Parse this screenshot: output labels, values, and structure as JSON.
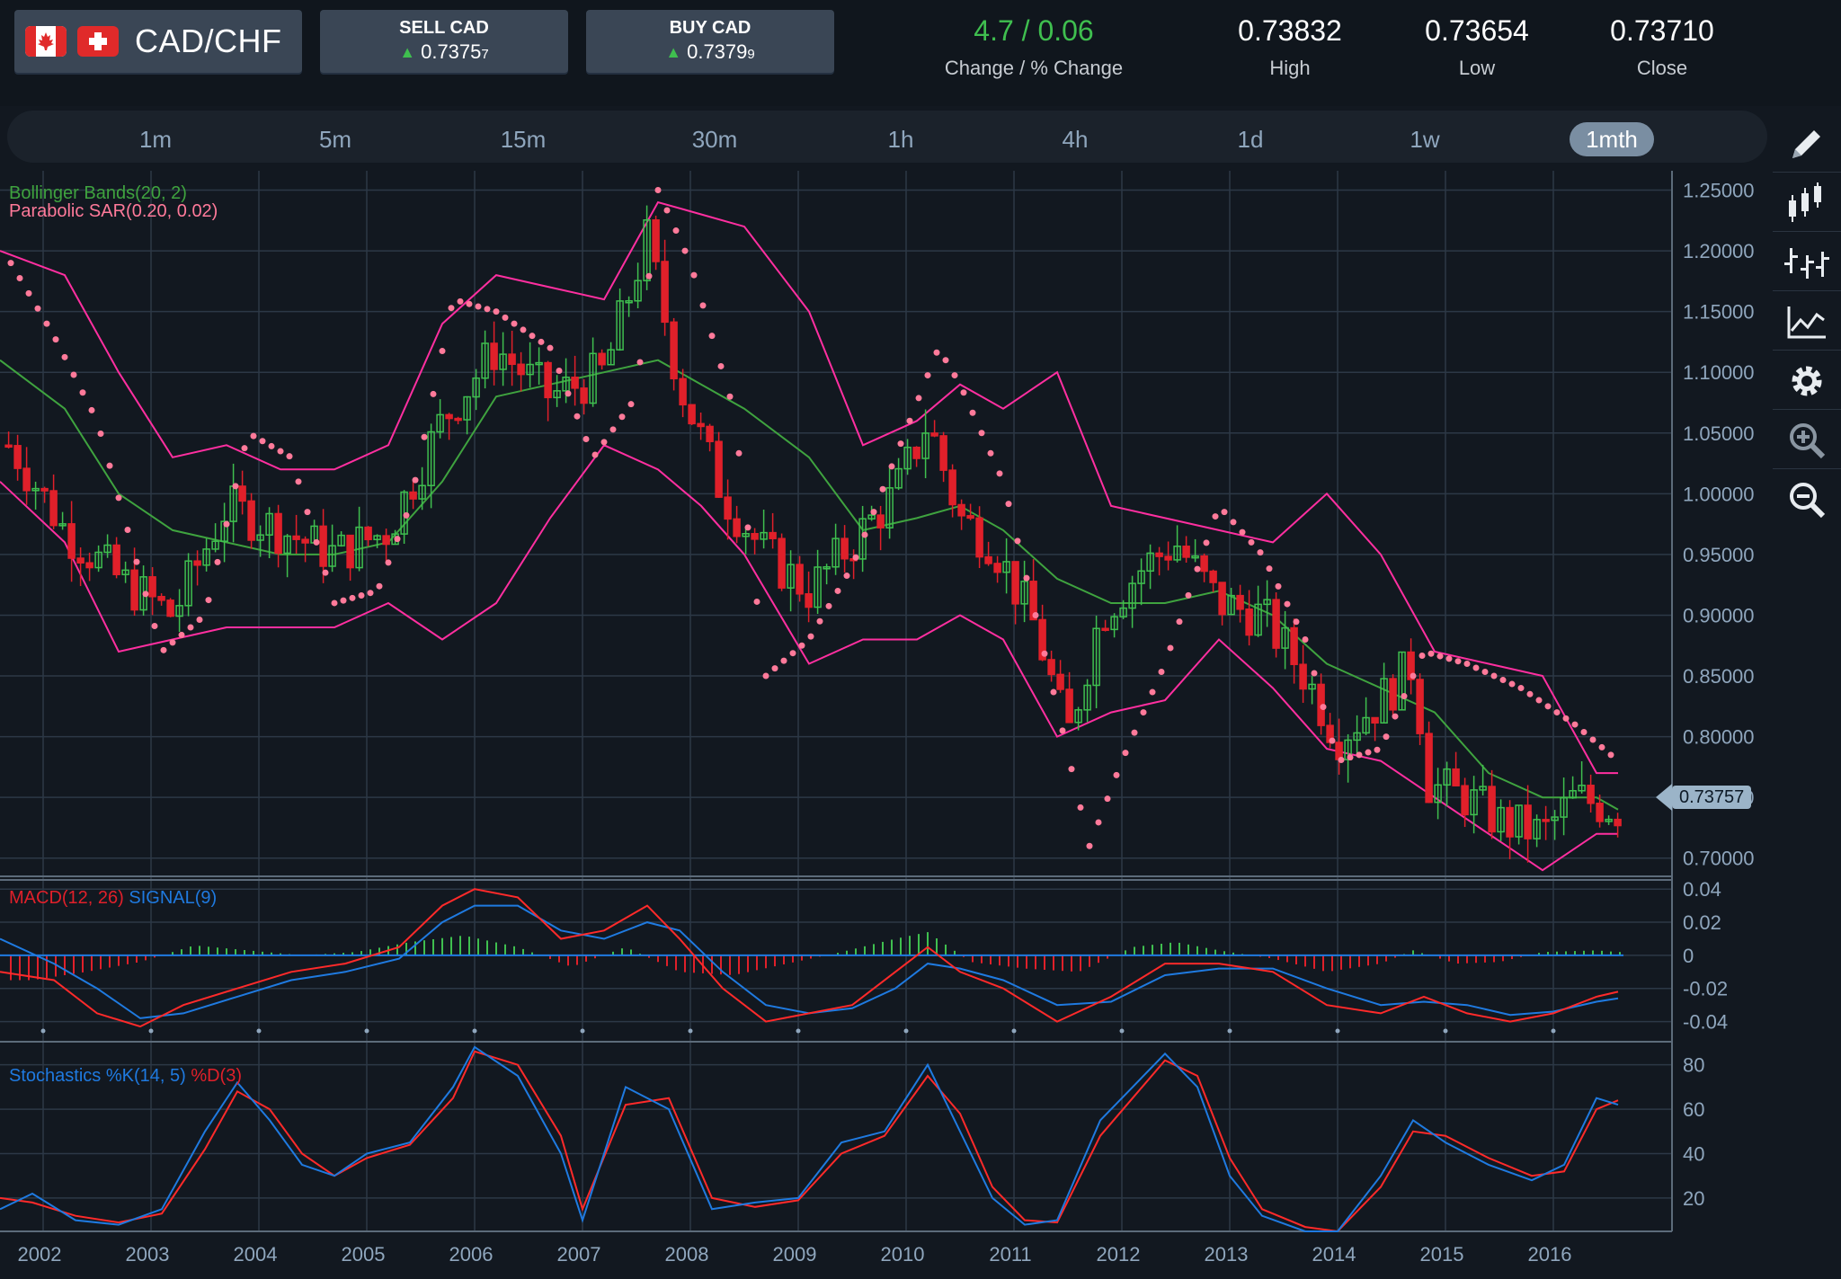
{
  "pair": {
    "name": "CAD/CHF",
    "flag_left": "canada-flag",
    "flag_right": "switzerland-flag"
  },
  "sell": {
    "label": "SELL CAD",
    "price": "0.7375",
    "pip": "7",
    "arrow_icon": "triangle-up-icon"
  },
  "buy": {
    "label": "BUY CAD",
    "price": "0.7379",
    "pip": "9",
    "arrow_icon": "triangle-up-icon"
  },
  "stats": [
    {
      "value": "4.7 / 0.06",
      "label": "Change / % Change",
      "color": "#3fbf4f"
    },
    {
      "value": "0.73832",
      "label": "High",
      "color": "#ffffff"
    },
    {
      "value": "0.73654",
      "label": "Low",
      "color": "#ffffff"
    },
    {
      "value": "0.73710",
      "label": "Close",
      "color": "#ffffff"
    }
  ],
  "timeframes": [
    "1m",
    "5m",
    "15m",
    "30m",
    "1h",
    "4h",
    "1d",
    "1w",
    "1mth"
  ],
  "active_timeframe": "1mth",
  "tools": [
    "pencil-icon",
    "candlestick-icon",
    "bar-chart-icon",
    "line-chart-icon",
    "gear-icon",
    "zoom-in-icon",
    "zoom-out-icon"
  ],
  "legends": {
    "bollinger": "Bollinger Bands(20, 2)",
    "sar": "Parabolic SAR(0.20, 0.02)",
    "macd": "MACD(12, 26)",
    "signal": "SIGNAL(9)",
    "stoch_k": "Stochastics %K(14, 5)",
    "stoch_d": "%D(3)"
  },
  "current_price": "0.73757",
  "colors": {
    "up": "#3fbf4f",
    "down": "#e0202a",
    "bands": "#ff2fa0",
    "mid": "#3fa33f",
    "sar": "#ff7a9a",
    "signal": "#1f7ae0",
    "macd": "#ff2a2a"
  },
  "chart_data": [
    {
      "type": "candlestick",
      "title": "",
      "x_ticks": [
        "2002",
        "2003",
        "2004",
        "2005",
        "2006",
        "2007",
        "2008",
        "2009",
        "2010",
        "2011",
        "2012",
        "2013",
        "2014",
        "2015",
        "2016"
      ],
      "y_ticks": [
        "1.25000",
        "1.20000",
        "1.15000",
        "1.10000",
        "1.05000",
        "1.00000",
        "0.95000",
        "0.90000",
        "0.85000",
        "0.80000",
        "0.75000",
        "0.70000"
      ],
      "ylim": [
        0.685,
        1.26
      ],
      "xlim": [
        2001.7,
        2017.2
      ],
      "series": [
        {
          "name": "Close",
          "x": [
            2001.8,
            2002.3,
            2002.8,
            2003.3,
            2003.8,
            2004.3,
            2004.8,
            2005.3,
            2005.8,
            2006.3,
            2006.8,
            2007.3,
            2007.7,
            2008.0,
            2008.4,
            2008.8,
            2009.2,
            2009.6,
            2010.0,
            2010.3,
            2010.6,
            2010.9,
            2011.3,
            2011.6,
            2011.9,
            2012.3,
            2012.6,
            2013.0,
            2013.4,
            2013.8,
            2014.1,
            2014.5,
            2014.8,
            2014.95,
            2015.3,
            2015.6,
            2016.0,
            2016.3,
            2016.7
          ],
          "y": [
            1.04,
            0.97,
            0.93,
            0.9,
            0.99,
            0.97,
            0.95,
            0.97,
            1.06,
            1.12,
            1.08,
            1.1,
            1.21,
            1.09,
            1.0,
            0.95,
            0.92,
            0.96,
            1.0,
            1.06,
            0.98,
            0.96,
            0.89,
            0.8,
            0.9,
            0.94,
            0.96,
            0.91,
            0.9,
            0.85,
            0.8,
            0.83,
            0.86,
            0.76,
            0.75,
            0.73,
            0.72,
            0.75,
            0.74
          ]
        },
        {
          "name": "Bollinger upper",
          "x": [
            2001.7,
            2002.3,
            2002.8,
            2003.3,
            2003.8,
            2004.3,
            2004.8,
            2005.3,
            2005.8,
            2006.3,
            2006.8,
            2007.3,
            2007.8,
            2008.2,
            2008.6,
            2009.2,
            2009.7,
            2010.2,
            2010.6,
            2011.0,
            2011.5,
            2012.0,
            2012.5,
            2013.0,
            2013.5,
            2014.0,
            2014.5,
            2015.0,
            2015.5,
            2016.0,
            2016.5,
            2016.7
          ],
          "y": [
            1.2,
            1.18,
            1.1,
            1.03,
            1.04,
            1.02,
            1.02,
            1.04,
            1.14,
            1.18,
            1.17,
            1.16,
            1.24,
            1.23,
            1.22,
            1.15,
            1.04,
            1.06,
            1.09,
            1.07,
            1.1,
            0.99,
            0.98,
            0.97,
            0.96,
            1.0,
            0.95,
            0.87,
            0.86,
            0.85,
            0.77,
            0.77
          ]
        },
        {
          "name": "Bollinger middle",
          "x": [
            2001.7,
            2002.3,
            2002.8,
            2003.3,
            2003.8,
            2004.3,
            2004.8,
            2005.3,
            2005.8,
            2006.3,
            2006.8,
            2007.3,
            2007.8,
            2008.2,
            2008.6,
            2009.2,
            2009.7,
            2010.2,
            2010.6,
            2011.0,
            2011.5,
            2012.0,
            2012.5,
            2013.0,
            2013.5,
            2014.0,
            2014.5,
            2015.0,
            2015.5,
            2016.0,
            2016.5,
            2016.7
          ],
          "y": [
            1.11,
            1.07,
            1.0,
            0.97,
            0.96,
            0.95,
            0.95,
            0.96,
            1.01,
            1.08,
            1.09,
            1.1,
            1.11,
            1.09,
            1.07,
            1.03,
            0.97,
            0.98,
            0.99,
            0.97,
            0.93,
            0.91,
            0.91,
            0.92,
            0.9,
            0.86,
            0.84,
            0.82,
            0.77,
            0.75,
            0.75,
            0.74
          ]
        },
        {
          "name": "Bollinger lower",
          "x": [
            2001.7,
            2002.3,
            2002.8,
            2003.3,
            2003.8,
            2004.3,
            2004.8,
            2005.3,
            2005.8,
            2006.3,
            2006.8,
            2007.3,
            2007.8,
            2008.2,
            2008.6,
            2009.2,
            2009.7,
            2010.2,
            2010.6,
            2011.0,
            2011.5,
            2012.0,
            2012.5,
            2013.0,
            2013.5,
            2014.0,
            2014.5,
            2015.0,
            2015.5,
            2016.0,
            2016.5,
            2016.7
          ],
          "y": [
            1.01,
            0.96,
            0.87,
            0.88,
            0.89,
            0.89,
            0.89,
            0.91,
            0.88,
            0.91,
            0.98,
            1.04,
            1.02,
            0.99,
            0.95,
            0.86,
            0.88,
            0.88,
            0.9,
            0.88,
            0.8,
            0.82,
            0.83,
            0.88,
            0.84,
            0.79,
            0.78,
            0.75,
            0.72,
            0.69,
            0.72,
            0.72
          ]
        },
        {
          "name": "SAR",
          "x": [
            2001.8,
            2002.2,
            2002.6,
            2003.2,
            2003.6,
            2004.0,
            2004.4,
            2004.8,
            2005.2,
            2005.5,
            2005.9,
            2006.3,
            2006.8,
            2007.2,
            2007.6,
            2007.8,
            2008.1,
            2008.5,
            2008.8,
            2009.2,
            2009.6,
            2010.0,
            2010.4,
            2010.6,
            2011.0,
            2011.3,
            2011.8,
            2012.1,
            2012.5,
            2013.0,
            2013.4,
            2013.8,
            2014.1,
            2014.5,
            2014.9,
            2015.3,
            2015.8,
            2016.3,
            2016.7
          ],
          "y": [
            1.19,
            1.13,
            1.06,
            0.87,
            0.9,
            1.05,
            1.03,
            0.91,
            0.92,
            0.99,
            1.16,
            1.15,
            1.12,
            1.03,
            1.08,
            1.25,
            1.19,
            1.07,
            0.85,
            0.88,
            0.94,
            1.03,
            1.12,
            1.09,
            1.01,
            0.9,
            0.71,
            0.78,
            0.86,
            0.99,
            0.95,
            0.88,
            0.78,
            0.79,
            0.87,
            0.86,
            0.84,
            0.81,
            0.78
          ]
        }
      ]
    },
    {
      "type": "line",
      "title": "",
      "y_ticks": [
        "0.04",
        "0.02",
        "0",
        "-0.02",
        "-0.04"
      ],
      "ylim": [
        -0.05,
        0.045
      ],
      "series": [
        {
          "name": "MACD(12, 26)",
          "x": [
            2001.7,
            2002.2,
            2002.6,
            2003.0,
            2003.4,
            2003.9,
            2004.4,
            2004.9,
            2005.4,
            2005.8,
            2006.1,
            2006.5,
            2006.9,
            2007.3,
            2007.7,
            2008.0,
            2008.4,
            2008.8,
            2009.2,
            2009.6,
            2010.0,
            2010.3,
            2010.6,
            2011.0,
            2011.5,
            2012.0,
            2012.5,
            2013.0,
            2013.5,
            2014.0,
            2014.5,
            2014.9,
            2015.3,
            2015.7,
            2016.1,
            2016.5,
            2016.7
          ],
          "y": [
            -0.01,
            -0.015,
            -0.035,
            -0.043,
            -0.03,
            -0.02,
            -0.01,
            -0.005,
            0.005,
            0.03,
            0.04,
            0.035,
            0.01,
            0.015,
            0.03,
            0.01,
            -0.02,
            -0.04,
            -0.035,
            -0.03,
            -0.01,
            0.005,
            -0.01,
            -0.02,
            -0.04,
            -0.025,
            -0.005,
            -0.005,
            -0.01,
            -0.03,
            -0.035,
            -0.025,
            -0.035,
            -0.04,
            -0.035,
            -0.025,
            -0.022
          ]
        },
        {
          "name": "SIGNAL(9)",
          "x": [
            2001.7,
            2002.2,
            2002.6,
            2003.0,
            2003.4,
            2003.9,
            2004.4,
            2004.9,
            2005.4,
            2005.8,
            2006.1,
            2006.5,
            2006.9,
            2007.3,
            2007.7,
            2008.0,
            2008.4,
            2008.8,
            2009.2,
            2009.6,
            2010.0,
            2010.3,
            2010.6,
            2011.0,
            2011.5,
            2012.0,
            2012.5,
            2013.0,
            2013.5,
            2014.0,
            2014.5,
            2014.9,
            2015.3,
            2015.7,
            2016.1,
            2016.5,
            2016.7
          ],
          "y": [
            0.01,
            -0.005,
            -0.02,
            -0.038,
            -0.035,
            -0.025,
            -0.015,
            -0.01,
            -0.002,
            0.02,
            0.03,
            0.03,
            0.015,
            0.01,
            0.02,
            0.015,
            -0.01,
            -0.03,
            -0.035,
            -0.032,
            -0.02,
            -0.005,
            -0.008,
            -0.015,
            -0.03,
            -0.028,
            -0.012,
            -0.008,
            -0.008,
            -0.02,
            -0.03,
            -0.028,
            -0.03,
            -0.036,
            -0.034,
            -0.028,
            -0.026
          ]
        },
        {
          "name": "Histogram",
          "x": [
            2002.0,
            2002.5,
            2003.0,
            2003.5,
            2004.0,
            2004.5,
            2005.0,
            2005.5,
            2006.0,
            2006.5,
            2007.0,
            2007.5,
            2008.0,
            2008.5,
            2009.0,
            2009.5,
            2010.0,
            2010.3,
            2010.7,
            2011.2,
            2011.7,
            2012.2,
            2012.6,
            2013.0,
            2013.5,
            2014.0,
            2014.5,
            2014.8,
            2015.2,
            2015.6,
            2016.0,
            2016.5,
            2016.7
          ],
          "y": [
            -0.015,
            -0.01,
            -0.004,
            0.006,
            0.003,
            0.0,
            0.002,
            0.008,
            0.012,
            0.005,
            -0.007,
            0.005,
            -0.01,
            -0.012,
            -0.005,
            0.002,
            0.01,
            0.014,
            -0.004,
            -0.008,
            -0.01,
            0.005,
            0.008,
            0.003,
            -0.002,
            -0.01,
            -0.005,
            0.003,
            -0.005,
            -0.004,
            0.002,
            0.003,
            0.002
          ]
        }
      ]
    },
    {
      "type": "line",
      "title": "",
      "y_ticks": [
        "80",
        "60",
        "40",
        "20"
      ],
      "ylim": [
        5,
        92
      ],
      "series": [
        {
          "name": "Stochastics %K(14, 5)",
          "x": [
            2001.7,
            2002.0,
            2002.4,
            2002.8,
            2003.2,
            2003.6,
            2003.9,
            2004.2,
            2004.5,
            2004.8,
            2005.1,
            2005.5,
            2005.9,
            2006.1,
            2006.5,
            2006.9,
            2007.1,
            2007.5,
            2007.9,
            2008.3,
            2008.7,
            2009.1,
            2009.5,
            2009.9,
            2010.3,
            2010.6,
            2010.9,
            2011.2,
            2011.5,
            2011.9,
            2012.2,
            2012.5,
            2012.8,
            2013.1,
            2013.4,
            2013.8,
            2014.1,
            2014.5,
            2014.8,
            2015.1,
            2015.5,
            2015.9,
            2016.2,
            2016.5,
            2016.7
          ],
          "y": [
            15,
            22,
            10,
            8,
            15,
            50,
            72,
            55,
            35,
            30,
            40,
            45,
            70,
            88,
            75,
            40,
            10,
            70,
            60,
            15,
            18,
            20,
            45,
            50,
            80,
            50,
            20,
            8,
            10,
            55,
            70,
            85,
            70,
            30,
            12,
            5,
            5,
            30,
            55,
            45,
            35,
            28,
            35,
            65,
            62
          ]
        },
        {
          "name": "%D(3)",
          "x": [
            2001.7,
            2002.0,
            2002.4,
            2002.8,
            2003.2,
            2003.6,
            2003.9,
            2004.2,
            2004.5,
            2004.8,
            2005.1,
            2005.5,
            2005.9,
            2006.1,
            2006.5,
            2006.9,
            2007.1,
            2007.5,
            2007.9,
            2008.3,
            2008.7,
            2009.1,
            2009.5,
            2009.9,
            2010.3,
            2010.6,
            2010.9,
            2011.2,
            2011.5,
            2011.9,
            2012.2,
            2012.5,
            2012.8,
            2013.1,
            2013.4,
            2013.8,
            2014.1,
            2014.5,
            2014.8,
            2015.1,
            2015.5,
            2015.9,
            2016.2,
            2016.5,
            2016.7
          ],
          "y": [
            20,
            18,
            12,
            9,
            13,
            42,
            68,
            60,
            40,
            30,
            38,
            44,
            65,
            86,
            80,
            48,
            15,
            62,
            65,
            20,
            16,
            19,
            40,
            48,
            75,
            58,
            25,
            10,
            9,
            48,
            65,
            82,
            75,
            38,
            15,
            7,
            5,
            25,
            50,
            48,
            38,
            30,
            32,
            60,
            64
          ]
        }
      ]
    }
  ]
}
